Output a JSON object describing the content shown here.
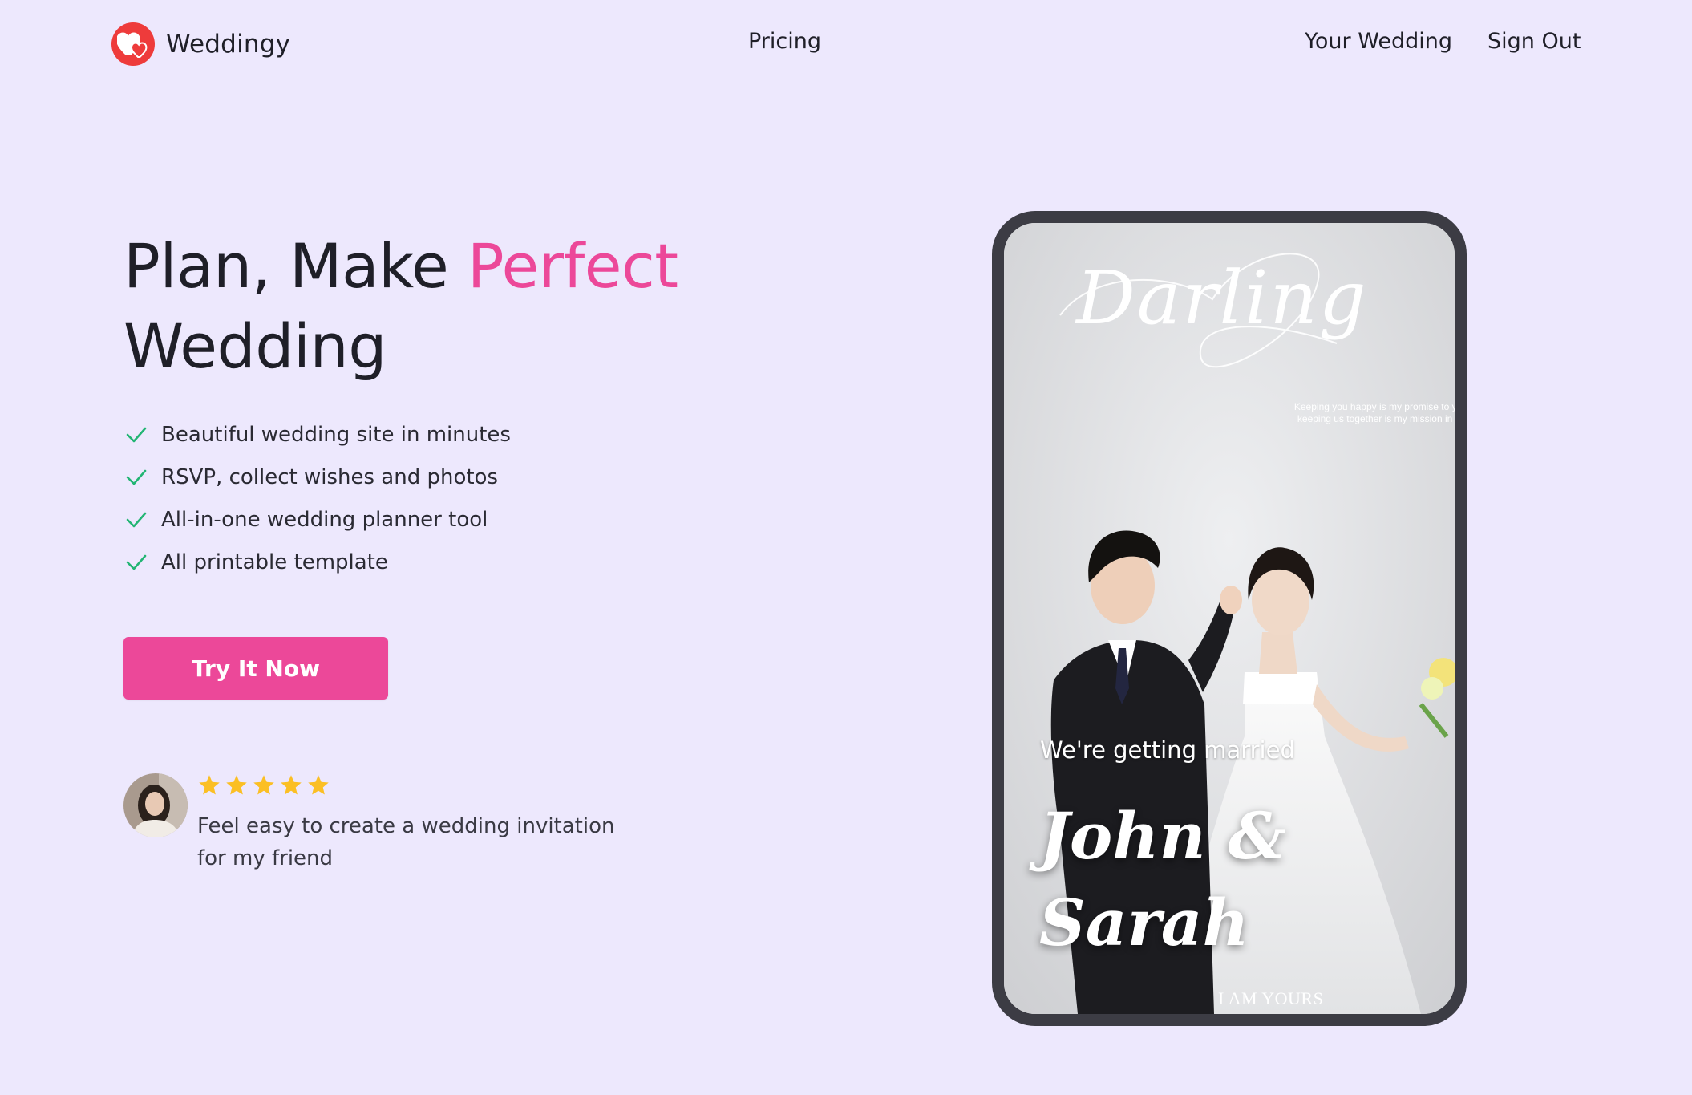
{
  "header": {
    "brand": "Weddingy",
    "nav": {
      "pricing": "Pricing",
      "your_wedding": "Your Wedding",
      "sign_out": "Sign Out"
    }
  },
  "hero": {
    "title_line1_plain": "Plan, Make ",
    "title_line1_accent": "Perfect",
    "title_line2": "Wedding",
    "features": [
      "Beautiful wedding site in minutes",
      "RSVP, collect wishes and photos",
      "All-in-one wedding planner tool",
      "All printable template"
    ],
    "cta_label": "Try It Now"
  },
  "review": {
    "rating": 5,
    "text": "Feel easy to create a wedding invitation for my friend"
  },
  "preview": {
    "script_title": "Darling",
    "tagline_line1": "Keeping you happy is my promise to you",
    "tagline_line2": "keeping us together is my mission in life",
    "subtitle": "We're getting married",
    "couple_line1": "John &",
    "couple_line2": "Sarah",
    "footer": "I AM YOURS"
  },
  "colors": {
    "background": "#ede8fd",
    "accent": "#ec4899",
    "check": "#22b573",
    "star": "#fbbf24",
    "logo_red": "#ee3b3b",
    "phone_frame": "#3c3c44"
  },
  "icons": {
    "logo": "heart-icon",
    "feature_bullet": "check-icon",
    "rating": "star-icon"
  }
}
